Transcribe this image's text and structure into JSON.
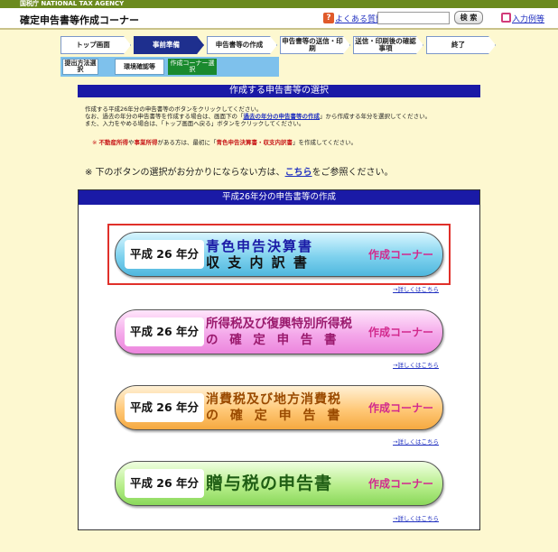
{
  "agency_bar": {
    "text": "国税庁  NATIONAL TAX AGENCY"
  },
  "header": {
    "title": "確定申告書等作成コーナー",
    "help_icon_text": "?",
    "help_link": "よくある質問",
    "search_placeholder": "",
    "search_button": "検 索",
    "example_link": "入力例等"
  },
  "steps": [
    {
      "label": "トップ画面"
    },
    {
      "label": "事前準備"
    },
    {
      "label": "申告書等の作成"
    },
    {
      "label": "申告書等の送信・印刷"
    },
    {
      "label": "送信・印刷後の確認事項"
    },
    {
      "label": "終了"
    }
  ],
  "substeps": [
    {
      "label": "提出方法選択"
    },
    {
      "label": "環境確認等"
    },
    {
      "label": "作成コーナー選択"
    }
  ],
  "section_title": "作成する申告書等の選択",
  "intro": {
    "line1": "作成する平成26年分の申告書等のボタンをクリックしてください。",
    "line2a": "なお、過去の年分の申告書等を作成する場合は、画面下の「",
    "line2b": "過去の年分の申告書等の作成",
    "line2c": "」から作成する年分を選択してください。",
    "line3": "また、入力をやめる場合は、「トップ画面へ戻る」ボタンをクリックしてください。"
  },
  "notice": {
    "mark": "※",
    "a": "不動産所得",
    "b": "や",
    "c": "事業所得",
    "d": "がある方は、最初に「",
    "e": "青色申告決算書・収支内訳書",
    "f": "」を作成してください。"
  },
  "guide": {
    "a": "※ 下のボタンの選択がお分かりにならない方は、",
    "link": "こちら",
    "b": "をご参照ください。"
  },
  "panel_title": "平成26年分の申告書等の作成",
  "options": [
    {
      "year": "平成 26 年分",
      "line1": "青色申告決算書",
      "line2": "収 支 内 訳 書",
      "corner": "作成コーナー",
      "detail": "→詳しくはこちら",
      "color": "#1a1aa6"
    },
    {
      "year": "平成 26 年分",
      "line1": "所得税及び復興特別所得税",
      "line2": "の 確 定 申 告 書",
      "corner": "作成コーナー",
      "detail": "→詳しくはこちら",
      "color": "#9b1a6e"
    },
    {
      "year": "平成 26 年分",
      "line1": "消費税及び地方消費税",
      "line2": "の 確 定 申 告 書",
      "corner": "作成コーナー",
      "detail": "→詳しくはこちら",
      "color": "#9a4a00"
    },
    {
      "year": "平成 26 年分",
      "line1": "贈与税の申告書",
      "line2": "",
      "corner": "作成コーナー",
      "detail": "→詳しくはこちら",
      "color": "#1f5e14"
    }
  ]
}
